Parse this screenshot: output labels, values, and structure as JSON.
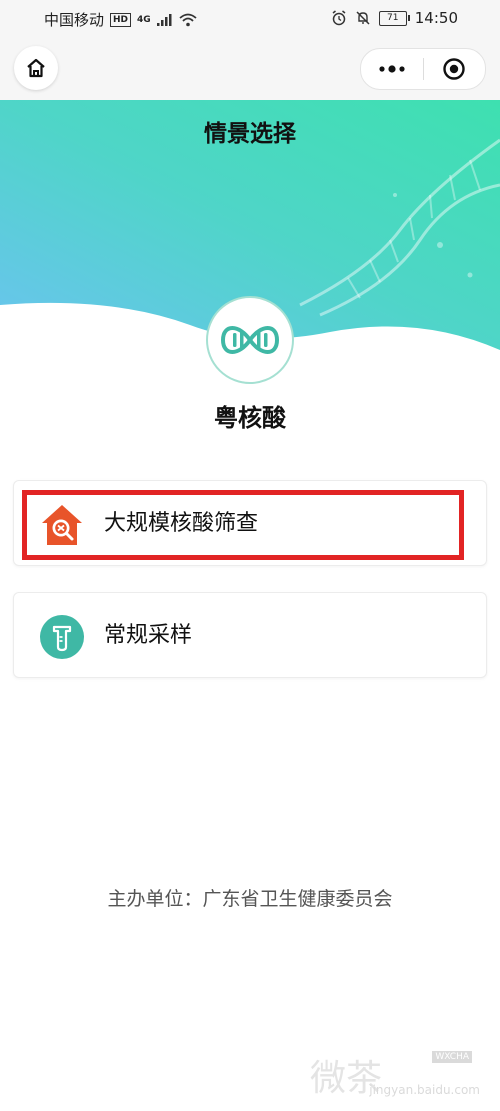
{
  "status_bar": {
    "carrier": "中国移动",
    "hd": "HD",
    "network": "4G",
    "battery": "71",
    "time": "14:50"
  },
  "nav": {
    "home_icon": "home-icon",
    "more_icon": "more-dots-icon",
    "close_icon": "target-circle-icon"
  },
  "page": {
    "title": "情景选择",
    "app_name": "粤核酸"
  },
  "options": [
    {
      "label": "大规模核酸筛查",
      "icon": "house-search-icon",
      "color": "#e8542a"
    },
    {
      "label": "常规采样",
      "icon": "test-tube-icon",
      "color": "#3fb8a5"
    }
  ],
  "footer": {
    "organizer": "主办单位：广东省卫生健康委员会"
  },
  "watermark": {
    "text": "微茶",
    "tag": "WXCHA",
    "url": "jingyan.baidu.com"
  },
  "colors": {
    "accent_teal": "#3fb8a5",
    "highlight_red": "#e22424",
    "banner_start": "#6bc3f0",
    "banner_end": "#3ee0b0"
  }
}
